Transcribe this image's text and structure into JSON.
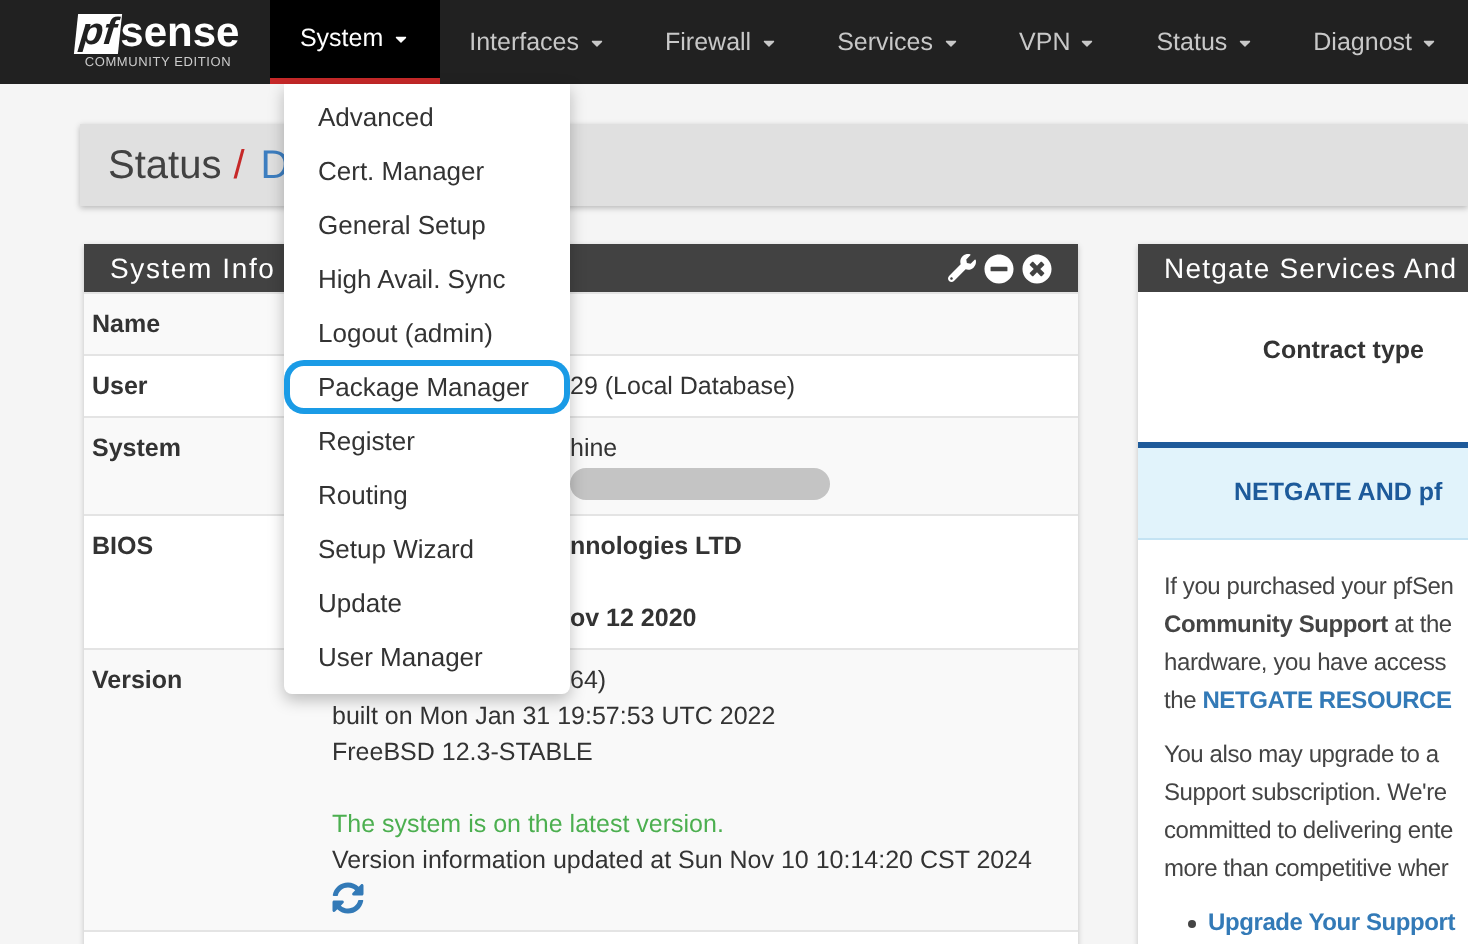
{
  "logo": {
    "mark": "pf",
    "name": "sense",
    "tagline": "COMMUNITY EDITION"
  },
  "nav": [
    {
      "label": "System",
      "selected": true
    },
    {
      "label": "Interfaces",
      "selected": false
    },
    {
      "label": "Firewall",
      "selected": false
    },
    {
      "label": "Services",
      "selected": false
    },
    {
      "label": "VPN",
      "selected": false
    },
    {
      "label": "Status",
      "selected": false
    },
    {
      "label": "Diagnost",
      "selected": false
    }
  ],
  "dropdown": [
    {
      "label": "Advanced",
      "selected": false
    },
    {
      "label": "Cert. Manager",
      "selected": false
    },
    {
      "label": "General Setup",
      "selected": false
    },
    {
      "label": "High Avail. Sync",
      "selected": false
    },
    {
      "label": "Logout (admin)",
      "selected": false
    },
    {
      "label": "Package Manager",
      "selected": true
    },
    {
      "label": "Register",
      "selected": false
    },
    {
      "label": "Routing",
      "selected": false
    },
    {
      "label": "Setup Wizard",
      "selected": false
    },
    {
      "label": "Update",
      "selected": false
    },
    {
      "label": "User Manager",
      "selected": false
    }
  ],
  "breadcrumb": {
    "section": "Status",
    "separator": "/",
    "page": "D"
  },
  "system_info": {
    "title": "System Info",
    "rows": [
      {
        "label": "Name",
        "lines": []
      },
      {
        "label": "User",
        "lines": [
          {
            "kind": "fragment",
            "text": "29 (Local Database)"
          }
        ]
      },
      {
        "label": "System",
        "lines": [
          {
            "kind": "fragment",
            "text": "hine"
          },
          {
            "kind": "redacted"
          }
        ]
      },
      {
        "label": "BIOS",
        "lines": [
          {
            "kind": "strongfragment",
            "text": "nnologies LTD"
          },
          {
            "kind": "spacer"
          },
          {
            "kind": "strongfragment",
            "text": "ov 12 2020"
          }
        ]
      },
      {
        "label": "Version",
        "lines": [
          {
            "kind": "fragment",
            "text": "64)"
          },
          {
            "kind": "line",
            "text": "built on Mon Jan 31 19:57:53 UTC 2022"
          },
          {
            "kind": "line",
            "text": "FreeBSD 12.3-STABLE"
          },
          {
            "kind": "spacer"
          },
          {
            "kind": "notice",
            "text": "The system is on the latest version."
          },
          {
            "kind": "line",
            "text": "Version information updated at Sun Nov 10 10:14:20 CST 2024"
          },
          {
            "kind": "refresh"
          }
        ]
      }
    ]
  },
  "netgate": {
    "title": "Netgate Services And",
    "contract_label": "Contract type",
    "banner": "NETGATE AND pf",
    "paragraphs": [
      {
        "lines": [
          [
            {
              "kind": "plain",
              "text": "If you purchased your pfSen"
            }
          ],
          [
            {
              "kind": "plain",
              "text": "**Community Support** at the"
            }
          ],
          [
            {
              "kind": "plain",
              "text": "hardware, you have access"
            }
          ],
          [
            {
              "kind": "plain",
              "text": "the "
            },
            {
              "kind": "link",
              "text": "NETGATE RESOURCE"
            }
          ]
        ]
      },
      {
        "lines": [
          [
            {
              "kind": "plain",
              "text": "You also may upgrade to a"
            }
          ],
          [
            {
              "kind": "plain",
              "text": "Support subscription. We're"
            }
          ],
          [
            {
              "kind": "plain",
              "text": "committed to delivering ente"
            }
          ],
          [
            {
              "kind": "plain",
              "text": "more than competitive wher"
            }
          ]
        ]
      }
    ],
    "links": [
      "Upgrade Your Support"
    ]
  }
}
